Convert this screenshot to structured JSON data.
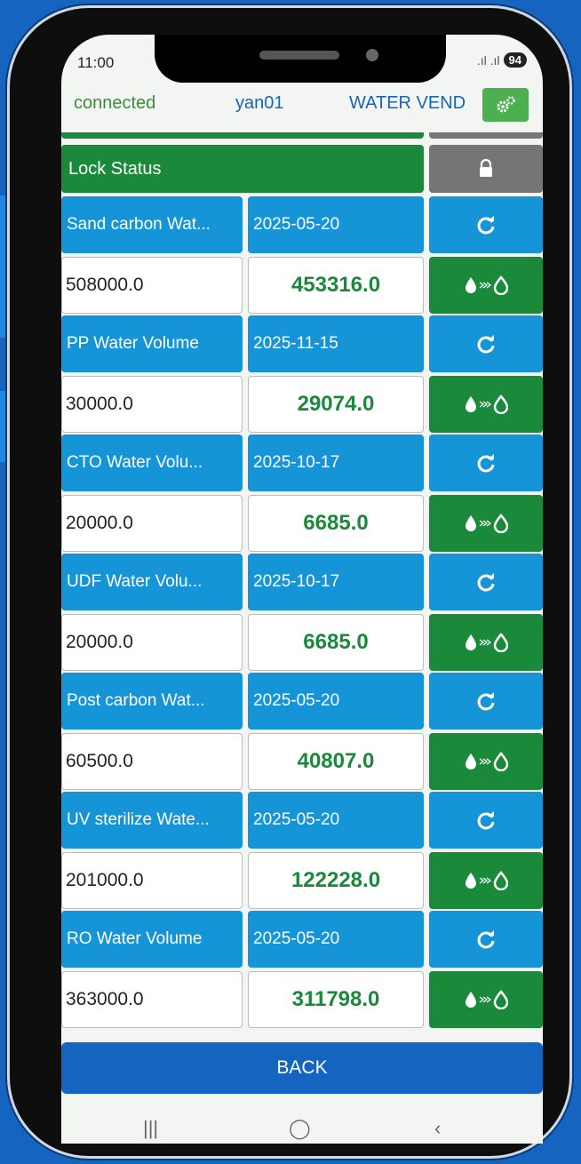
{
  "status_bar": {
    "time": "11:00",
    "battery": "94"
  },
  "app_bar": {
    "connection": "connected",
    "device": "yan01",
    "title": "WATER VEND",
    "settings_icon": "gears-icon"
  },
  "lock": {
    "label": "Lock Status",
    "icon": "lock-icon"
  },
  "filters": [
    {
      "name": "Sand carbon Wat...",
      "date": "2025-05-20",
      "total": "508000.0",
      "remaining": "453316.0"
    },
    {
      "name": "PP Water Volume",
      "date": "2025-11-15",
      "total": "30000.0",
      "remaining": "29074.0"
    },
    {
      "name": "CTO Water Volu...",
      "date": "2025-10-17",
      "total": "20000.0",
      "remaining": "6685.0"
    },
    {
      "name": "UDF Water Volu...",
      "date": "2025-10-17",
      "total": "20000.0",
      "remaining": "6685.0"
    },
    {
      "name": "Post carbon Wat...",
      "date": "2025-05-20",
      "total": "60500.0",
      "remaining": "40807.0"
    },
    {
      "name": "UV sterilize Wate...",
      "date": "2025-05-20",
      "total": "201000.0",
      "remaining": "122228.0"
    },
    {
      "name": "RO Water Volume",
      "date": "2025-05-20",
      "total": "363000.0",
      "remaining": "311798.0"
    }
  ],
  "back_label": "BACK",
  "colors": {
    "green": "#1a8a3a",
    "blue": "#1694d8",
    "gray": "#757575",
    "back": "#1565c0"
  }
}
